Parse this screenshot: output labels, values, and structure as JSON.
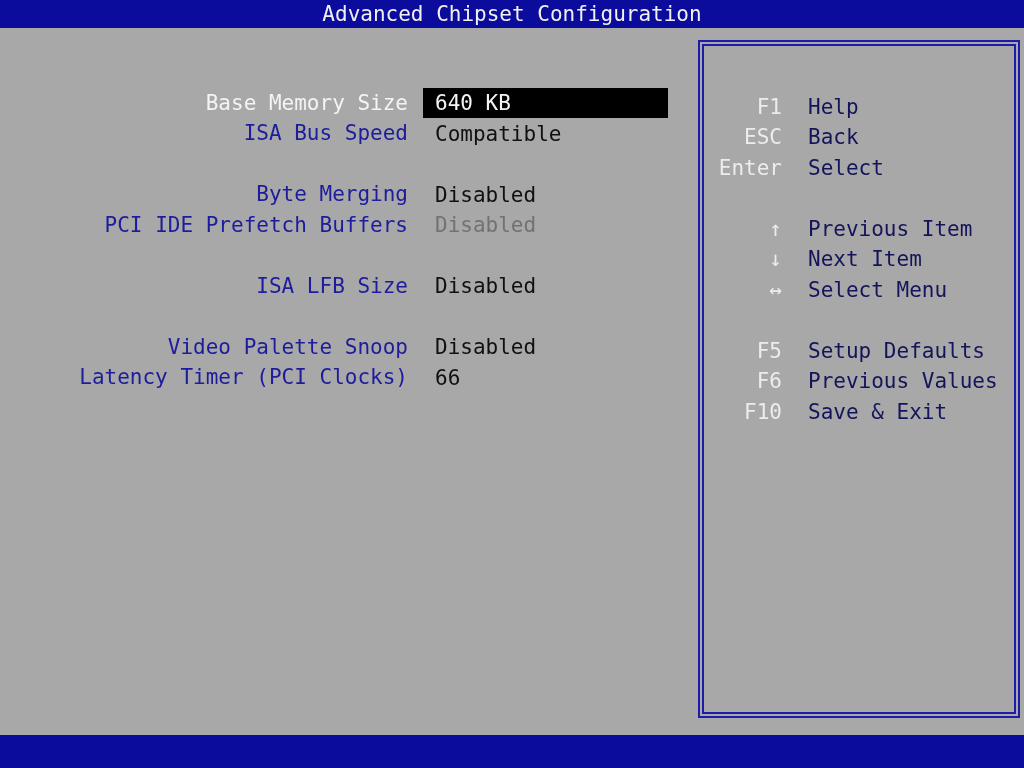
{
  "title": "Advanced Chipset Configuration",
  "settings": [
    [
      {
        "label": "Base Memory Size",
        "value": "640 KB",
        "selected": true,
        "disabled": false
      },
      {
        "label": "ISA Bus Speed",
        "value": "Compatible",
        "selected": false,
        "disabled": false
      }
    ],
    [
      {
        "label": "Byte Merging",
        "value": "Disabled",
        "selected": false,
        "disabled": false
      },
      {
        "label": "PCI IDE Prefetch Buffers",
        "value": "Disabled",
        "selected": false,
        "disabled": true
      }
    ],
    [
      {
        "label": "ISA LFB Size",
        "value": "Disabled",
        "selected": false,
        "disabled": false
      }
    ],
    [
      {
        "label": "Video Palette Snoop",
        "value": "Disabled",
        "selected": false,
        "disabled": false
      },
      {
        "label": "Latency Timer (PCI Clocks)",
        "value": "66",
        "selected": false,
        "disabled": false
      }
    ]
  ],
  "help": [
    [
      {
        "key": "F1",
        "action": "Help"
      },
      {
        "key": "ESC",
        "action": "Back"
      },
      {
        "key": "Enter",
        "action": "Select"
      }
    ],
    [
      {
        "key": "↑",
        "action": "Previous Item"
      },
      {
        "key": "↓",
        "action": "Next Item"
      },
      {
        "key": "↔",
        "action": "Select Menu"
      }
    ],
    [
      {
        "key": "F5",
        "action": "Setup Defaults"
      },
      {
        "key": "F6",
        "action": "Previous Values"
      },
      {
        "key": "F10",
        "action": "Save & Exit"
      }
    ]
  ]
}
